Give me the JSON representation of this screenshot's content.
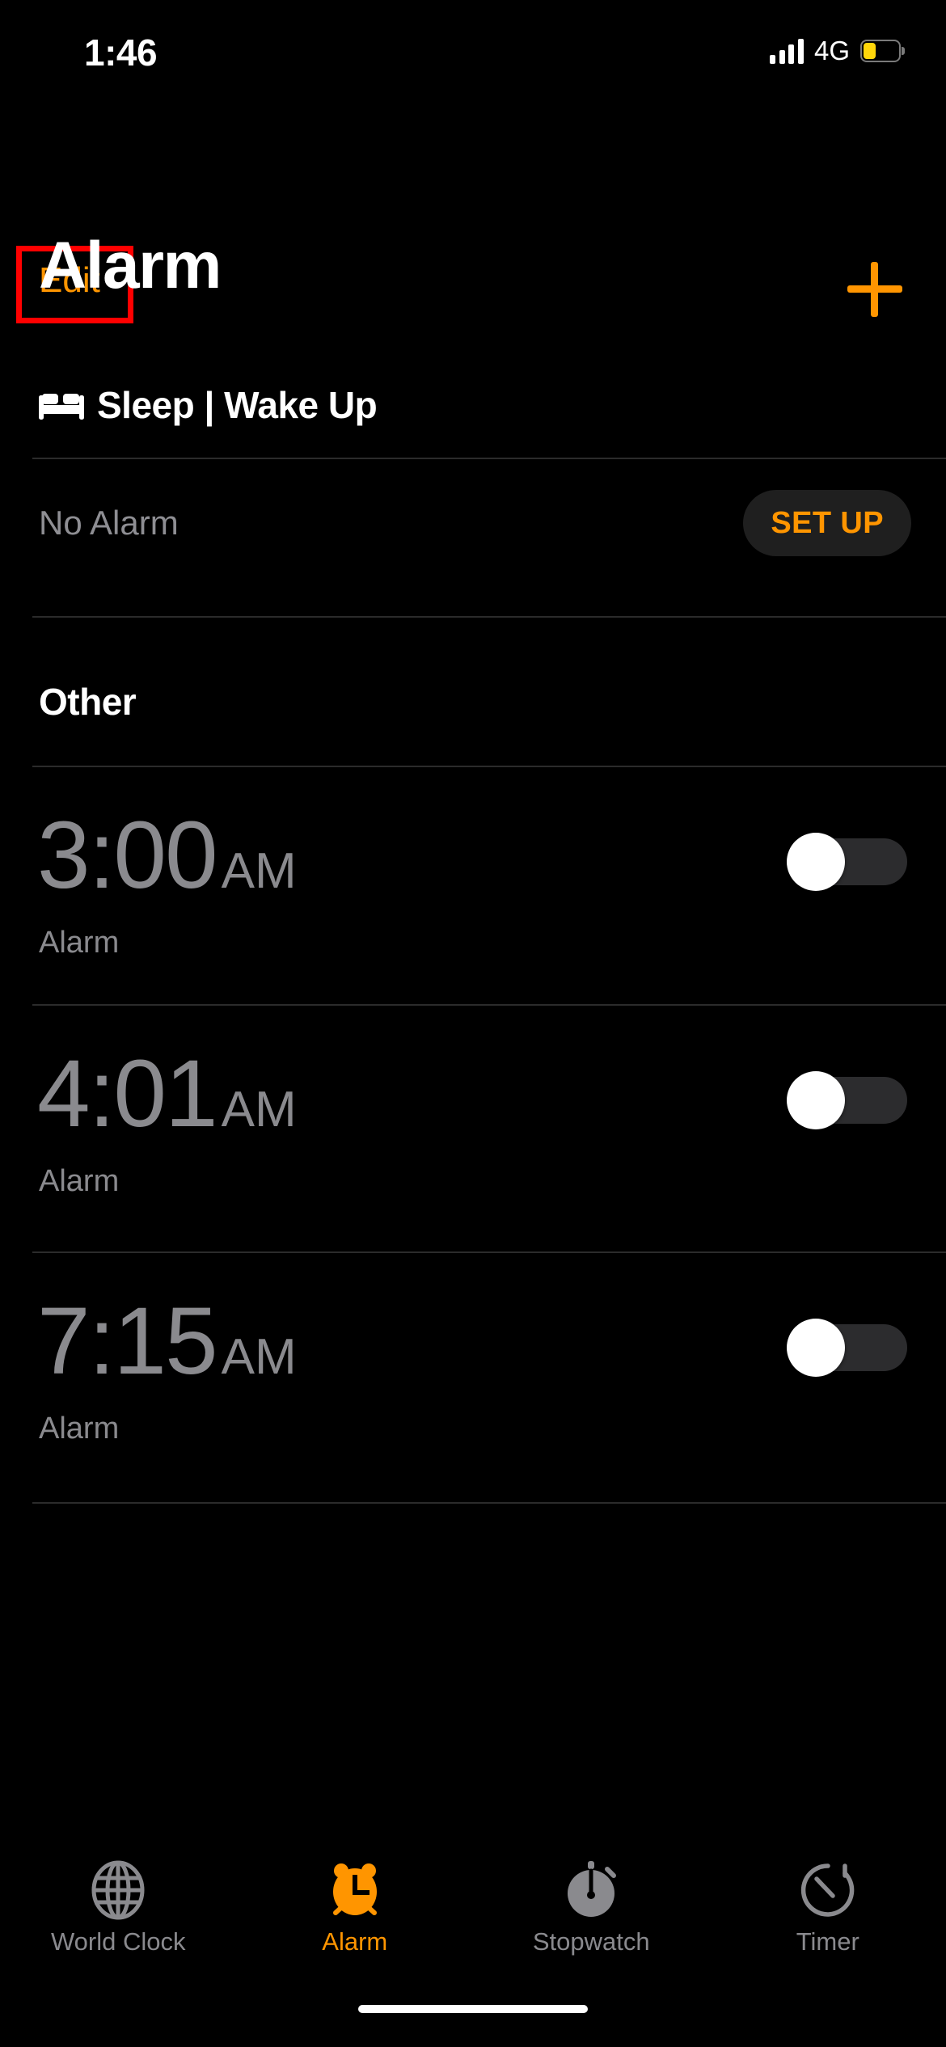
{
  "status_bar": {
    "time": "1:46",
    "network_type": "4G",
    "signal_bars": 4,
    "battery_percent": 35,
    "battery_color": "#FFD60A",
    "signal_icon": "cellular-signal-icon",
    "battery_icon": "battery-icon"
  },
  "nav": {
    "edit_label": "Edit",
    "add_icon": "plus-icon",
    "accent_color": "#FF9500",
    "highlight_color": "#FF0000"
  },
  "header": {
    "title": "Alarm"
  },
  "sleep_section": {
    "icon": "bed-icon",
    "header_label": "Sleep | Wake Up",
    "status_text": "No Alarm",
    "action_label": "SET UP"
  },
  "other_section": {
    "header_label": "Other",
    "alarms": [
      {
        "time": "3:00",
        "meridiem": "AM",
        "label": "Alarm",
        "enabled": false
      },
      {
        "time": "4:01",
        "meridiem": "AM",
        "label": "Alarm",
        "enabled": false
      },
      {
        "time": "7:15",
        "meridiem": "AM",
        "label": "Alarm",
        "enabled": false
      }
    ]
  },
  "tab_bar": {
    "items": [
      {
        "label": "World Clock",
        "icon": "globe-icon",
        "active": false
      },
      {
        "label": "Alarm",
        "icon": "alarm-clock-icon",
        "active": true
      },
      {
        "label": "Stopwatch",
        "icon": "stopwatch-icon",
        "active": false
      },
      {
        "label": "Timer",
        "icon": "timer-icon",
        "active": false
      }
    ],
    "active_color": "#FF9500",
    "inactive_color": "#8A8A8E"
  }
}
